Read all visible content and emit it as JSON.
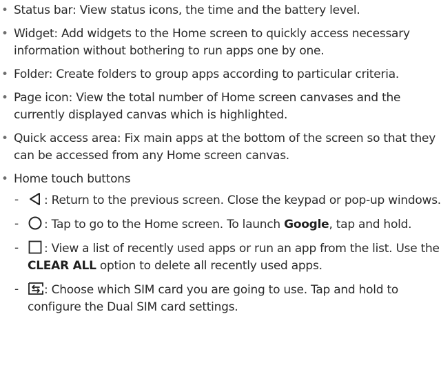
{
  "items": [
    {
      "label": "Status bar",
      "sep": ": ",
      "text": "View status icons, the time and the battery level."
    },
    {
      "label": "Widget",
      "sep": ": ",
      "text": "Add widgets to the Home screen to quickly access necessary information without bothering to run apps one by one."
    },
    {
      "label": "Folder",
      "sep": ": ",
      "text": "Create folders to group apps according to particular criteria."
    },
    {
      "label": "Page icon",
      "sep": ": ",
      "text": "View the total number of Home screen canvases and the currently displayed canvas which is highlighted."
    },
    {
      "label": "Quick access area",
      "sep": ": ",
      "text": "Fix main apps at the bottom of the screen so that they can be accessed from any Home screen canvas."
    },
    {
      "label": "Home touch buttons"
    }
  ],
  "touch_buttons": {
    "back": {
      "icon": "back-triangle-icon",
      "text": "Return to the previous screen. Close the keypad or pop-up windows."
    },
    "home": {
      "icon": "home-circle-icon",
      "text_before": "Tap to go to the Home screen. To launch ",
      "bold": "Google",
      "text_after": ", tap and hold."
    },
    "recent": {
      "icon": "recent-square-icon",
      "text_before": "View a list of recently used apps or run an app from the list. Use the ",
      "bold": "CLEAR ALL",
      "text_after": " option to delete all recently used apps."
    },
    "sim": {
      "icon": "sim-switch-icon",
      "text": "Choose which SIM card you are going to use. Tap and hold to configure the Dual SIM card settings."
    }
  },
  "colors": {
    "text": "#2b2b2b",
    "bullet": "#6d6d6d"
  }
}
